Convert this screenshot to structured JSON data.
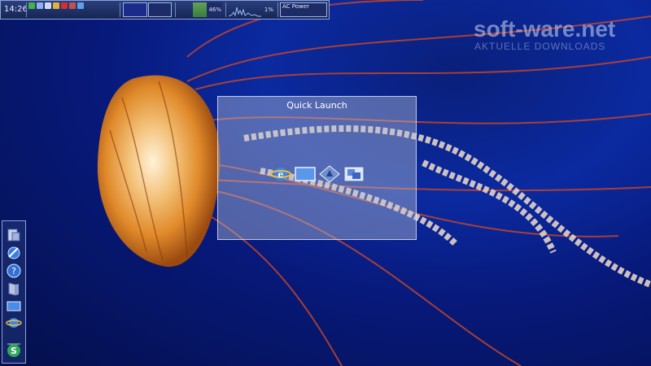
{
  "topbar": {
    "clock": "14:26",
    "tray_icons": [
      "network-icon",
      "display-icon",
      "volume-icon",
      "transfer-icon",
      "security-icon",
      "flag-icon",
      "monitor-icon"
    ],
    "pager": [
      "desktop-1",
      "desktop-2"
    ],
    "memory": {
      "label": "46%",
      "fill": 0.46
    },
    "cpu": {
      "label": "1%"
    },
    "power": {
      "label": "AC Power"
    }
  },
  "watermark": {
    "brand": "soft-ware.net",
    "subtitle": "AKTUELLE DOWNLOADS"
  },
  "quick_launch": {
    "title": "Quick Launch",
    "items": [
      "internet-explorer-icon",
      "show-desktop-icon",
      "media-icon",
      "switch-windows-icon"
    ]
  },
  "dock": {
    "items": [
      "file-manager-icon",
      "browser-icon",
      "help-icon",
      "documents-icon",
      "desktop-icon",
      "internet-explorer-icon",
      "separator",
      "app-icon"
    ]
  }
}
